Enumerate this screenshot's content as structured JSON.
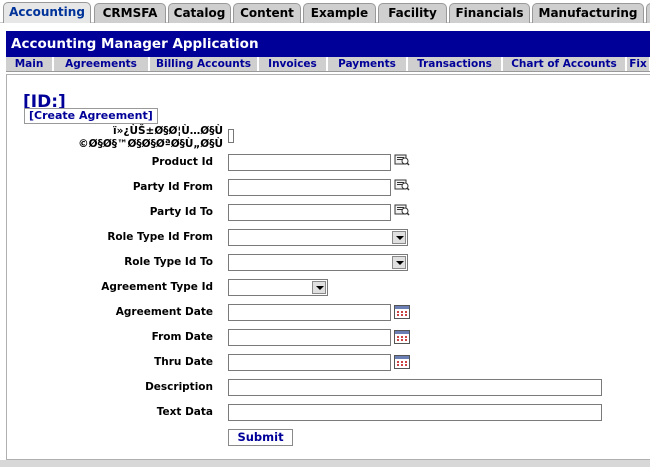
{
  "app_tabs": [
    {
      "label": "Accounting",
      "selected": true
    },
    {
      "label": "CRMSFA",
      "selected": false
    },
    {
      "label": "Catalog",
      "selected": false
    },
    {
      "label": "Content",
      "selected": false
    },
    {
      "label": "Example",
      "selected": false
    },
    {
      "label": "Facility",
      "selected": false
    },
    {
      "label": "Financials",
      "selected": false
    },
    {
      "label": "Manufacturing",
      "selected": false
    }
  ],
  "header": {
    "title": "Accounting Manager Application"
  },
  "sub_nav": [
    {
      "label": "Main"
    },
    {
      "label": "Agreements"
    },
    {
      "label": "Billing Accounts"
    },
    {
      "label": "Invoices"
    },
    {
      "label": "Payments"
    },
    {
      "label": "Transactions"
    },
    {
      "label": "Chart of Accounts"
    },
    {
      "label": "Fix"
    }
  ],
  "main": {
    "title": "[ID:]",
    "create_link": "[Create Agreement]",
    "garbled_line_1": "ï»¿ÙŠ±Ø§Ø¦Ù…Ø§Ù",
    "garbled_line_2": "©Ø§Ø§™Ø§Ø§ØªØ§Ù„Ø§Ù",
    "fields": [
      {
        "label": "Product Id",
        "value": "",
        "kind": "text-lookup"
      },
      {
        "label": "Party Id From",
        "value": "",
        "kind": "text-lookup"
      },
      {
        "label": "Party Id To",
        "value": "",
        "kind": "text-lookup"
      },
      {
        "label": "Role Type Id From",
        "value": "",
        "kind": "select"
      },
      {
        "label": "Role Type Id To",
        "value": "",
        "kind": "select"
      },
      {
        "label": "Agreement Type Id",
        "value": "",
        "kind": "select-short"
      },
      {
        "label": "Agreement Date",
        "value": "",
        "kind": "date"
      },
      {
        "label": "From Date",
        "value": "",
        "kind": "date"
      },
      {
        "label": "Thru Date",
        "value": "",
        "kind": "date"
      },
      {
        "label": "Description",
        "value": "",
        "kind": "text-wide"
      },
      {
        "label": "Text Data",
        "value": "",
        "kind": "text-wide"
      }
    ],
    "submit_label": "Submit"
  },
  "icons": {
    "lookup": "lookup-icon",
    "calendar": "calendar-icon",
    "dropdown": "chevron-down-icon"
  },
  "colors": {
    "title_bar": "#000099",
    "nav_text": "#000099",
    "tab_bg": "#cfcfcf"
  }
}
